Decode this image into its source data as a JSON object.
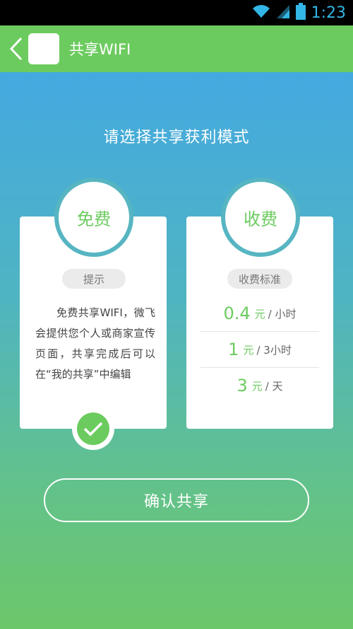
{
  "status_bar": {
    "time": "1:23",
    "icons": [
      "wifi-icon",
      "signal-icon",
      "battery-icon"
    ]
  },
  "app_bar": {
    "title": "共享WIFI",
    "back_icon": "chevron-left-icon"
  },
  "main": {
    "subtitle": "请选择共享获利模式",
    "free_card": {
      "mode_label": "免费",
      "pill_label": "提示",
      "description": "免费共享WIFI，微飞会提供您个人或商家宣传页面，共享完成后可以在“我的共享”中编辑",
      "selected": true
    },
    "paid_card": {
      "mode_label": "收费",
      "pill_label": "收费标准",
      "prices": [
        {
          "amount": "0.4",
          "unit": "元",
          "period": "/ 小时"
        },
        {
          "amount": "1",
          "unit": "元",
          "period": "/ 3小时"
        },
        {
          "amount": "3",
          "unit": "元",
          "period": "/ 天"
        }
      ]
    },
    "confirm_label": "确认共享"
  },
  "colors": {
    "accent_green": "#6ccb5f",
    "ring_teal": "#57b5c2",
    "gradient_top": "#44a9e0"
  }
}
